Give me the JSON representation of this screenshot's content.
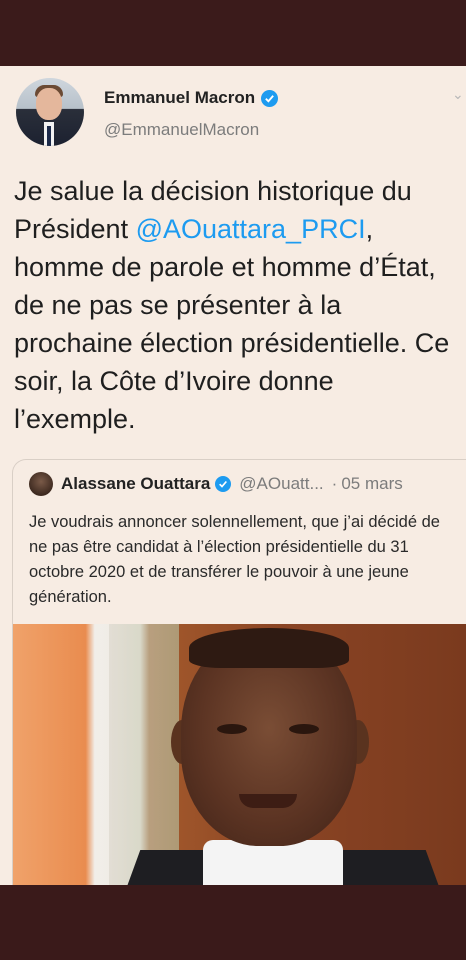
{
  "tweet": {
    "author": {
      "name": "Emmanuel Macron",
      "handle": "@EmmanuelMacron"
    },
    "text": {
      "part1": "Je salue la décision historique du Président ",
      "mention": "@AOuattara_PRCI",
      "part2": ", homme de parole et homme d’État, de ne pas se présenter à la prochaine élection présidentielle. Ce soir, la Côte d’Ivoire donne l’exemple."
    }
  },
  "quoted": {
    "name": "Alassane Ouattara",
    "handle": "@AOuatt...",
    "separator": "·",
    "date": "05 mars",
    "text": "Je voudrais annoncer solennellement, que j’ai décidé de ne pas être candidat à l’élection présidentielle du 31 octobre 2020 et de transférer le pouvoir à une jeune génération."
  },
  "colors": {
    "accent": "#1d9bf0",
    "card_bg": "#f7ece3",
    "frame": "#3a1a1a"
  }
}
